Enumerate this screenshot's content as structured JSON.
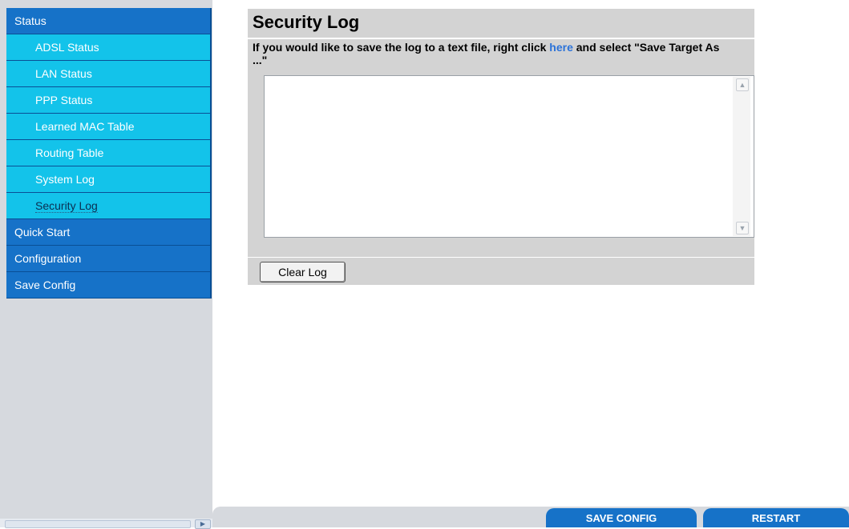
{
  "sidebar": {
    "items": [
      {
        "label": "Status",
        "type": "main"
      },
      {
        "label": "ADSL Status",
        "type": "sub"
      },
      {
        "label": "LAN Status",
        "type": "sub"
      },
      {
        "label": "PPP Status",
        "type": "sub"
      },
      {
        "label": "Learned MAC Table",
        "type": "sub"
      },
      {
        "label": "Routing Table",
        "type": "sub"
      },
      {
        "label": "System Log",
        "type": "sub"
      },
      {
        "label": "Security Log",
        "type": "sub",
        "active": true
      },
      {
        "label": "Quick Start",
        "type": "main"
      },
      {
        "label": "Configuration",
        "type": "main"
      },
      {
        "label": "Save Config",
        "type": "main"
      }
    ]
  },
  "main": {
    "title": "Security Log",
    "instructions_before": "If you would like to save the log to a text file, right click ",
    "link_text": "here",
    "instructions_after": " and select \"Save Target As ...\"",
    "log_value": "",
    "clear_button_label": "Clear Log"
  },
  "footer": {
    "save_config_label": "SAVE CONFIG",
    "restart_label": "RESTART"
  },
  "colors": {
    "main_menu": "#1672c8",
    "sub_menu": "#13c3ea",
    "panel_bg": "#d3d3d3",
    "link": "#2b72d8"
  }
}
